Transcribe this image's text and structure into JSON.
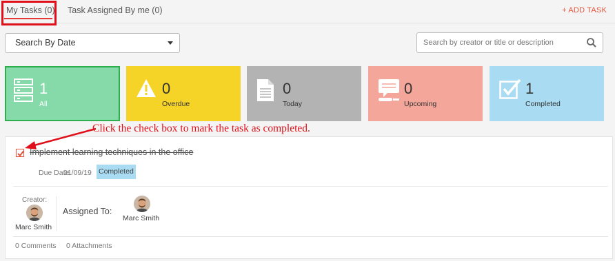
{
  "tabs": {
    "my_tasks": "My Tasks (0)",
    "assigned_by_me": "Task Assigned By me (0)",
    "add_task": "+ ADD TASK"
  },
  "filters": {
    "date_select": "Search By Date",
    "search_placeholder": "Search by creator or title or description"
  },
  "stats": [
    {
      "count": "1",
      "label": "All",
      "icon": "list-icon",
      "color": "#86d9a9"
    },
    {
      "count": "0",
      "label": "Overdue",
      "icon": "warning-icon",
      "color": "#f5d327"
    },
    {
      "count": "0",
      "label": "Today",
      "icon": "document-icon",
      "color": "#b3b3b3"
    },
    {
      "count": "0",
      "label": "Upcoming",
      "icon": "calendar-chat-icon",
      "color": "#f4a69a"
    },
    {
      "count": "1",
      "label": "Completed",
      "icon": "checkbox-icon",
      "color": "#a9dcf2"
    }
  ],
  "annotation": "Click the check box to mark the task as completed.",
  "task": {
    "title": "Implement learning techniques in the office",
    "due_label": "Due Date",
    "due_date": "01/09/19",
    "status": "Completed",
    "creator_label": "Creator:",
    "creator_name": "Marc Smith",
    "assigned_label": "Assigned To:",
    "assignee_name": "Marc Smith",
    "comments": "0 Comments",
    "attachments": "0 Attachments"
  },
  "colors": {
    "accent": "#e5533b",
    "highlight_red": "#e0101a",
    "all_border": "#2fae4e"
  }
}
